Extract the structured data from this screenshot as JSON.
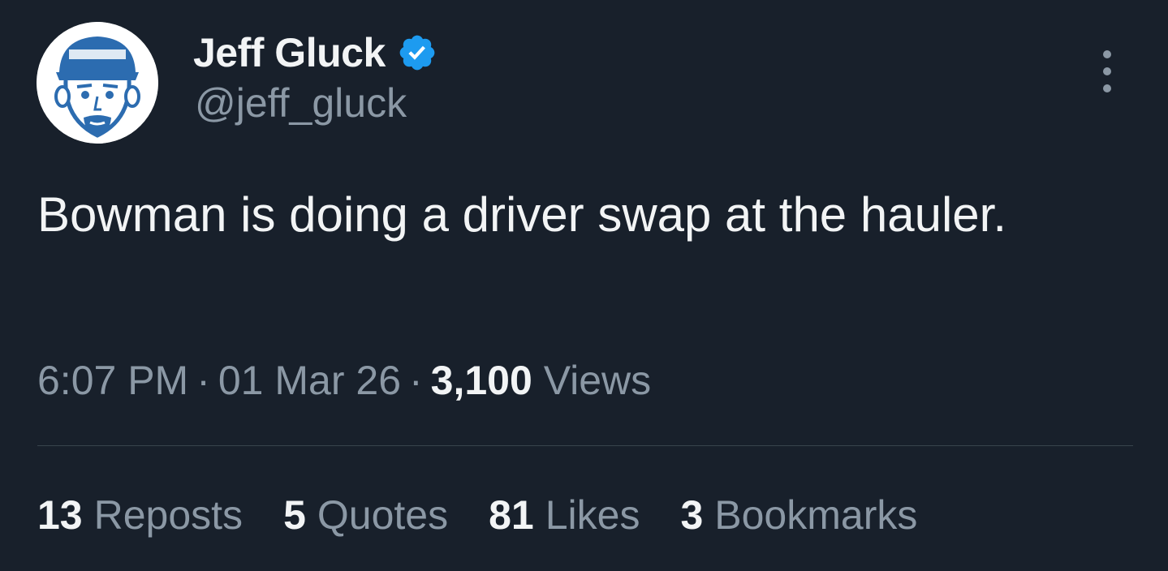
{
  "author": {
    "display_name": "Jeff Gluck",
    "handle": "@jeff_gluck",
    "verified_icon": "verified-badge",
    "avatar_icon": "cartoon-face-with-cap"
  },
  "tweet": {
    "text": "Bowman is doing a driver swap at the hauler.",
    "time": "6:07 PM",
    "separator": "·",
    "date": "01 Mar 26",
    "views_count": "3,100",
    "views_label": "Views"
  },
  "stats": [
    {
      "count": "13",
      "label": "Reposts"
    },
    {
      "count": "5",
      "label": "Quotes"
    },
    {
      "count": "81",
      "label": "Likes"
    },
    {
      "count": "3",
      "label": "Bookmarks"
    }
  ],
  "colors": {
    "background": "#18202b",
    "primary_text": "#f2f4f5",
    "secondary_text": "#8b98a5",
    "verified_blue": "#1d9bf0",
    "avatar_blue": "#2c6cb0"
  }
}
